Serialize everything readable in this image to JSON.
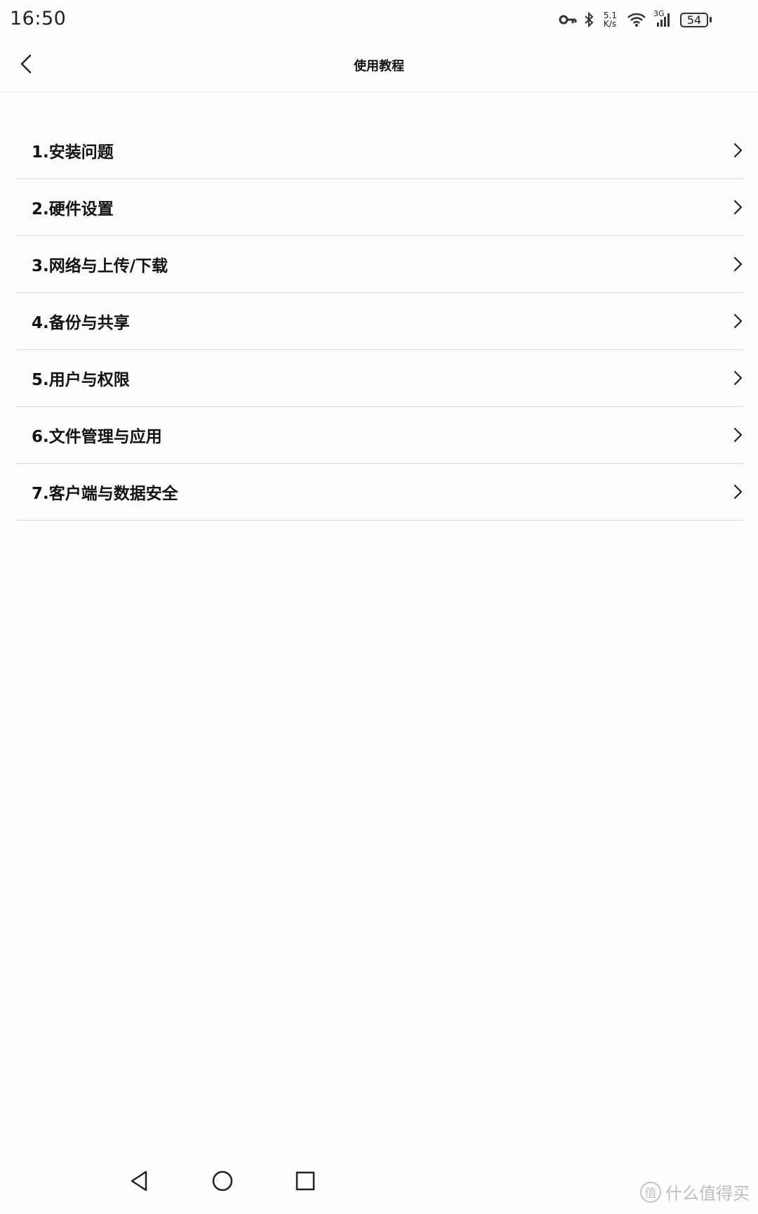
{
  "status_bar": {
    "time": "16:50",
    "net_speed_value": "5.1",
    "net_speed_unit": "K/s",
    "mobile_network": "3G",
    "battery_level": "54",
    "icons": [
      "key-icon",
      "bluetooth-icon",
      "wifi-icon",
      "signal-icon",
      "battery-icon"
    ]
  },
  "header": {
    "title": "使用教程",
    "back_icon": "chevron-left-icon"
  },
  "tutorial_items": [
    {
      "label": "1.安装问题"
    },
    {
      "label": "2.硬件设置"
    },
    {
      "label": "3.网络与上传/下载"
    },
    {
      "label": "4.备份与共享"
    },
    {
      "label": "5.用户与权限"
    },
    {
      "label": "6.文件管理与应用"
    },
    {
      "label": "7.客户端与数据安全"
    }
  ],
  "nav_bar": {
    "icons": [
      "nav-back-icon",
      "nav-home-icon",
      "nav-recents-icon"
    ]
  },
  "watermark": {
    "badge": "值",
    "text": "什么值得买"
  }
}
